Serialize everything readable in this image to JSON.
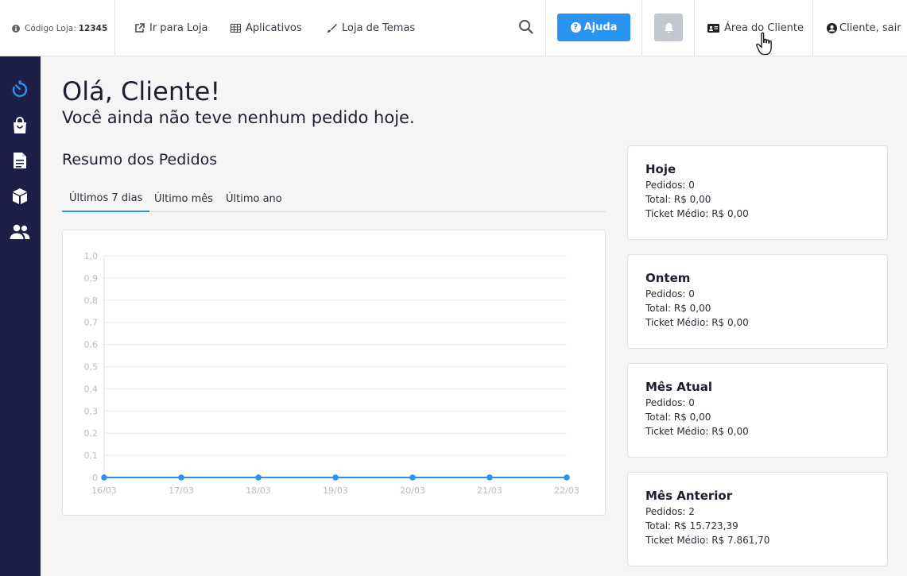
{
  "topbar": {
    "store_code_label": "Código Loja:",
    "store_code_value": "12345",
    "go_to_store": "Ir para Loja",
    "apps": "Aplicativos",
    "themes": "Loja de Temas",
    "help": "Ajuda",
    "client_area": "Área do Cliente",
    "logout": "Cliente, sair"
  },
  "main": {
    "greeting": "Olá, Cliente!",
    "subtitle": "Você ainda não teve nenhum pedido hoje.",
    "section_title": "Resumo dos Pedidos",
    "tabs": [
      {
        "label": "Últimos 7 dias",
        "active": true
      },
      {
        "label": "Último mês",
        "active": false
      },
      {
        "label": "Último ano",
        "active": false
      }
    ]
  },
  "cards": [
    {
      "title": "Hoje",
      "orders": "Pedidos: 0",
      "total": "Total: R$ 0,00",
      "ticket": "Ticket Médio: R$ 0,00"
    },
    {
      "title": "Ontem",
      "orders": "Pedidos: 0",
      "total": "Total: R$ 0,00",
      "ticket": "Ticket Médio: R$ 0,00"
    },
    {
      "title": "Mês Atual",
      "orders": "Pedidos: 0",
      "total": "Total: R$ 0,00",
      "ticket": "Ticket Médio: R$ 0,00"
    },
    {
      "title": "Mês Anterior",
      "orders": "Pedidos: 2",
      "total": "Total: R$ 15.723,39",
      "ticket": "Ticket Médio: R$ 7.861,70"
    }
  ],
  "colors": {
    "accent": "#2a93ef",
    "sidebar": "#1d1f48"
  },
  "chart_data": {
    "type": "line",
    "x": [
      "16/03",
      "17/03",
      "18/03",
      "19/03",
      "20/03",
      "21/03",
      "22/03"
    ],
    "series": [
      {
        "values": [
          0,
          0,
          0,
          0,
          0,
          0,
          0
        ]
      }
    ],
    "yticks": [
      "0",
      "0,1",
      "0,2",
      "0,3",
      "0,4",
      "0,5",
      "0,6",
      "0,7",
      "0,8",
      "0,9",
      "1,0"
    ],
    "ylim": [
      0,
      1.0
    ],
    "grid": true
  }
}
